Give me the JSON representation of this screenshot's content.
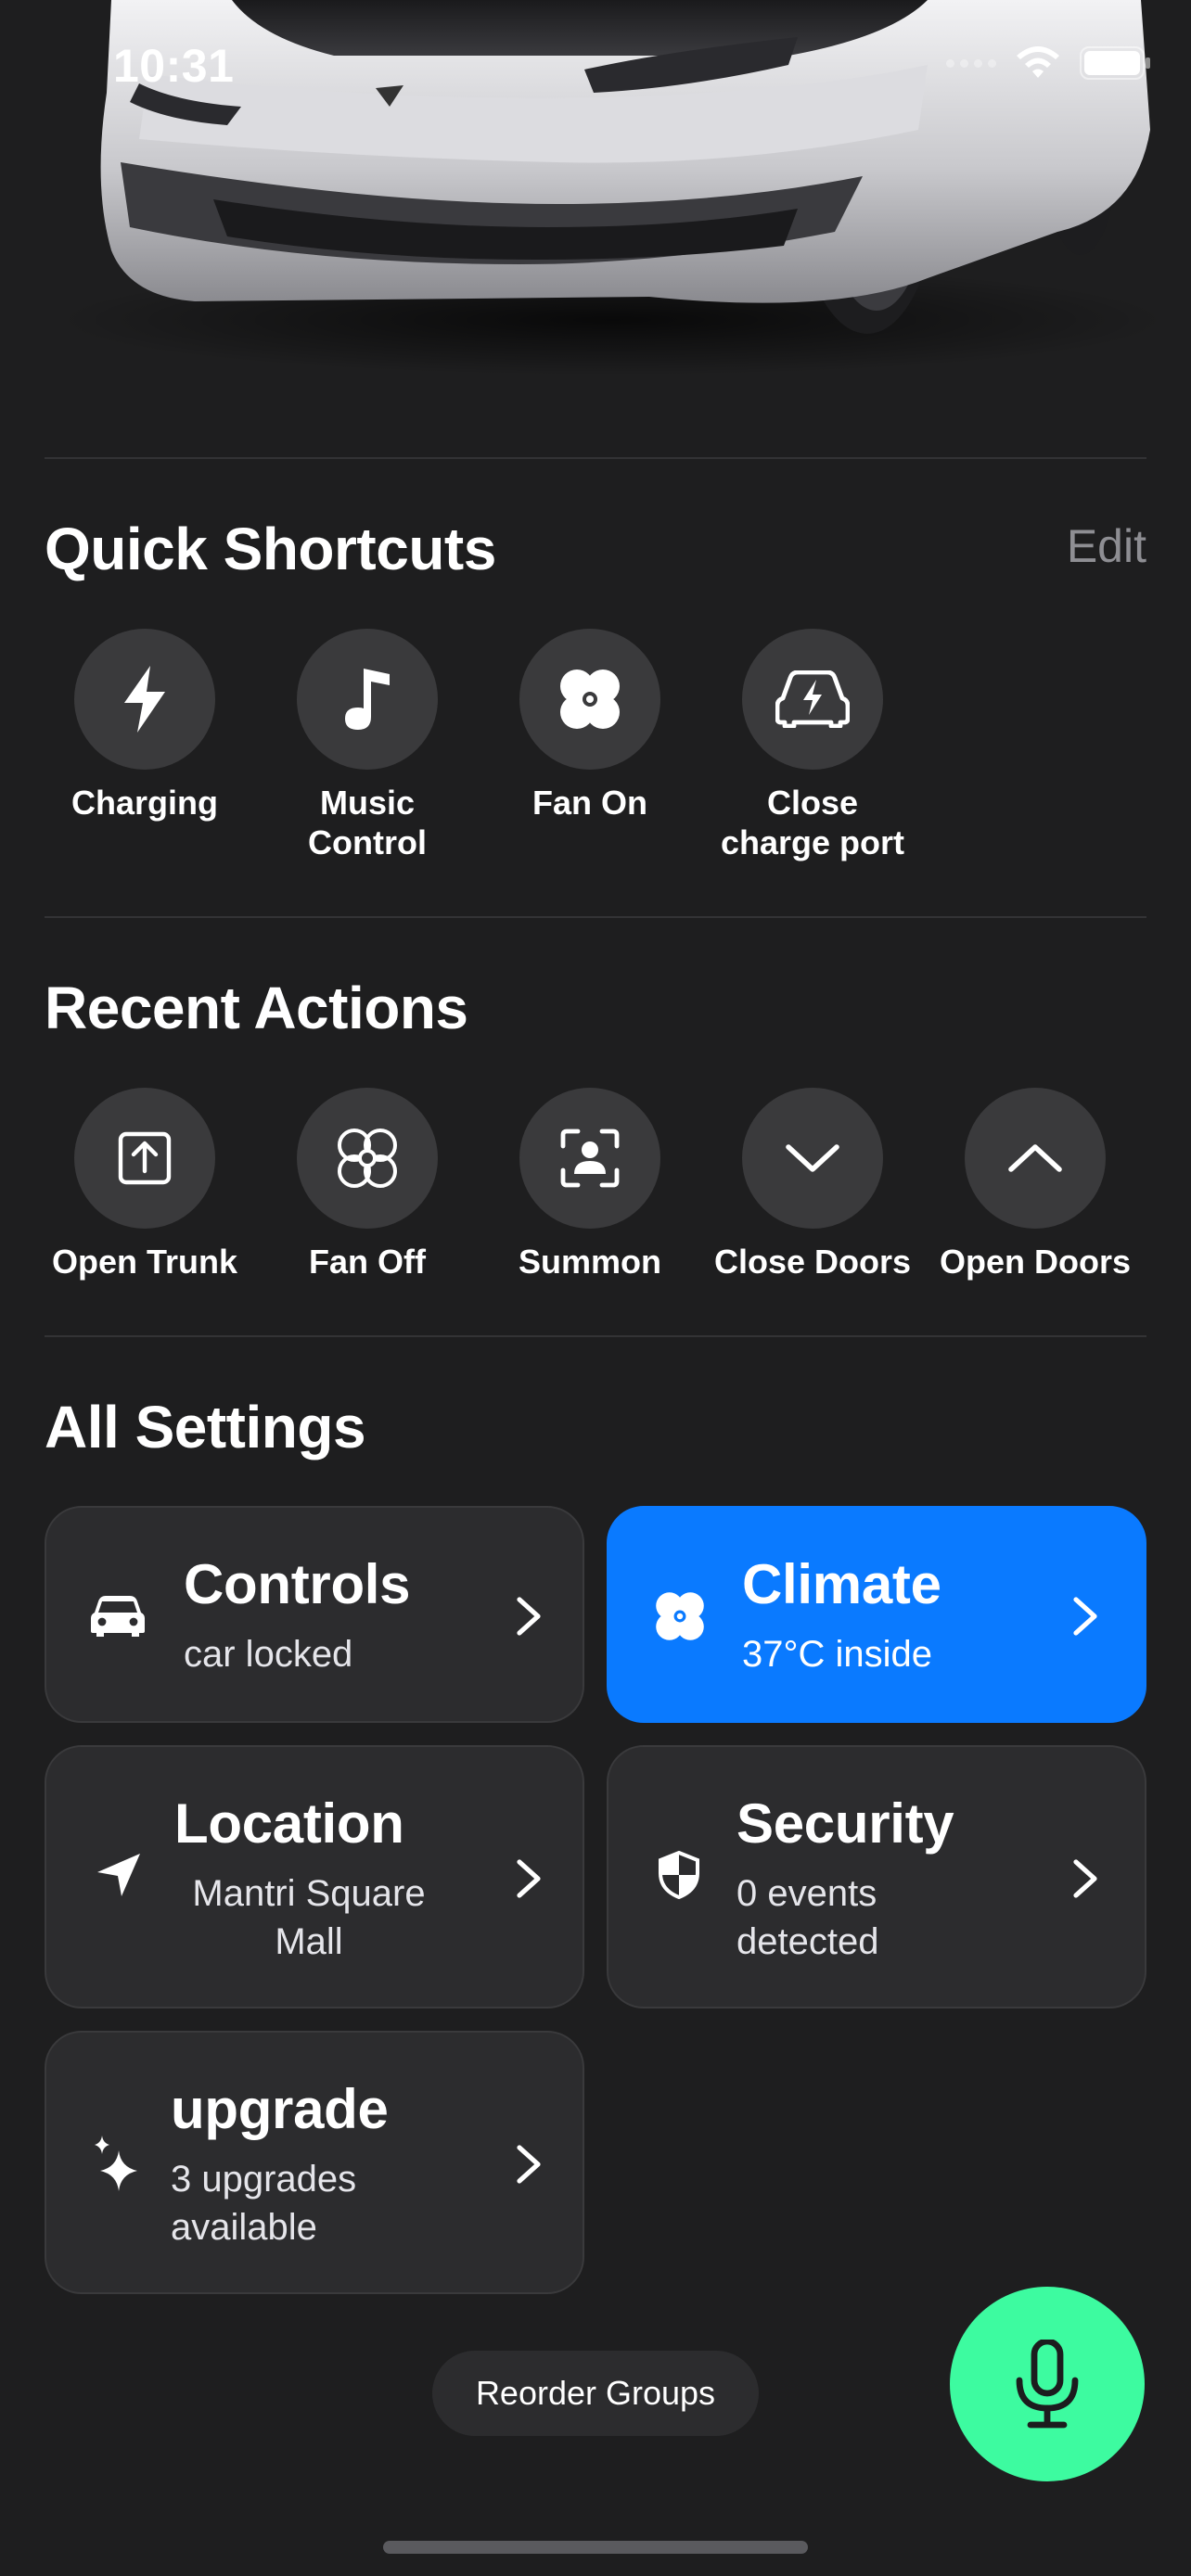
{
  "status_bar": {
    "time": "10:31"
  },
  "quick_shortcuts": {
    "title": "Quick Shortcuts",
    "edit_label": "Edit",
    "items": [
      {
        "label": "Charging",
        "icon": "bolt-icon"
      },
      {
        "label": "Music Control",
        "icon": "music-note-icon"
      },
      {
        "label": "Fan On",
        "icon": "fan-icon"
      },
      {
        "label": "Close charge port",
        "icon": "car-charging-icon"
      }
    ]
  },
  "recent_actions": {
    "title": "Recent Actions",
    "items": [
      {
        "label": "Open Trunk",
        "icon": "trunk-open-icon"
      },
      {
        "label": "Fan Off",
        "icon": "fan-outline-icon"
      },
      {
        "label": "Summon",
        "icon": "summon-icon"
      },
      {
        "label": "Close Doors",
        "icon": "chevron-down-icon"
      },
      {
        "label": "Open Doors",
        "icon": "chevron-up-icon"
      }
    ]
  },
  "all_settings": {
    "title": "All Settings",
    "cards": [
      {
        "title": "Controls",
        "subtitle": "car locked",
        "icon": "car-icon"
      },
      {
        "title": "Climate",
        "subtitle": "37°C inside",
        "icon": "fan-icon",
        "active": true
      },
      {
        "title": "Location",
        "subtitle": "Mantri Square Mall",
        "icon": "location-arrow-icon"
      },
      {
        "title": "Security",
        "subtitle": "0 events detected",
        "icon": "shield-icon"
      },
      {
        "title": "upgrade",
        "subtitle": "3 upgrades available",
        "icon": "sparkles-icon"
      }
    ]
  },
  "reorder_label": "Reorder Groups",
  "colors": {
    "background": "#1e1e1f",
    "card": "#2c2c2e",
    "active_card": "#0a7aff",
    "mic_button": "#3dfba0",
    "secondary_text": "#8e8e93"
  }
}
